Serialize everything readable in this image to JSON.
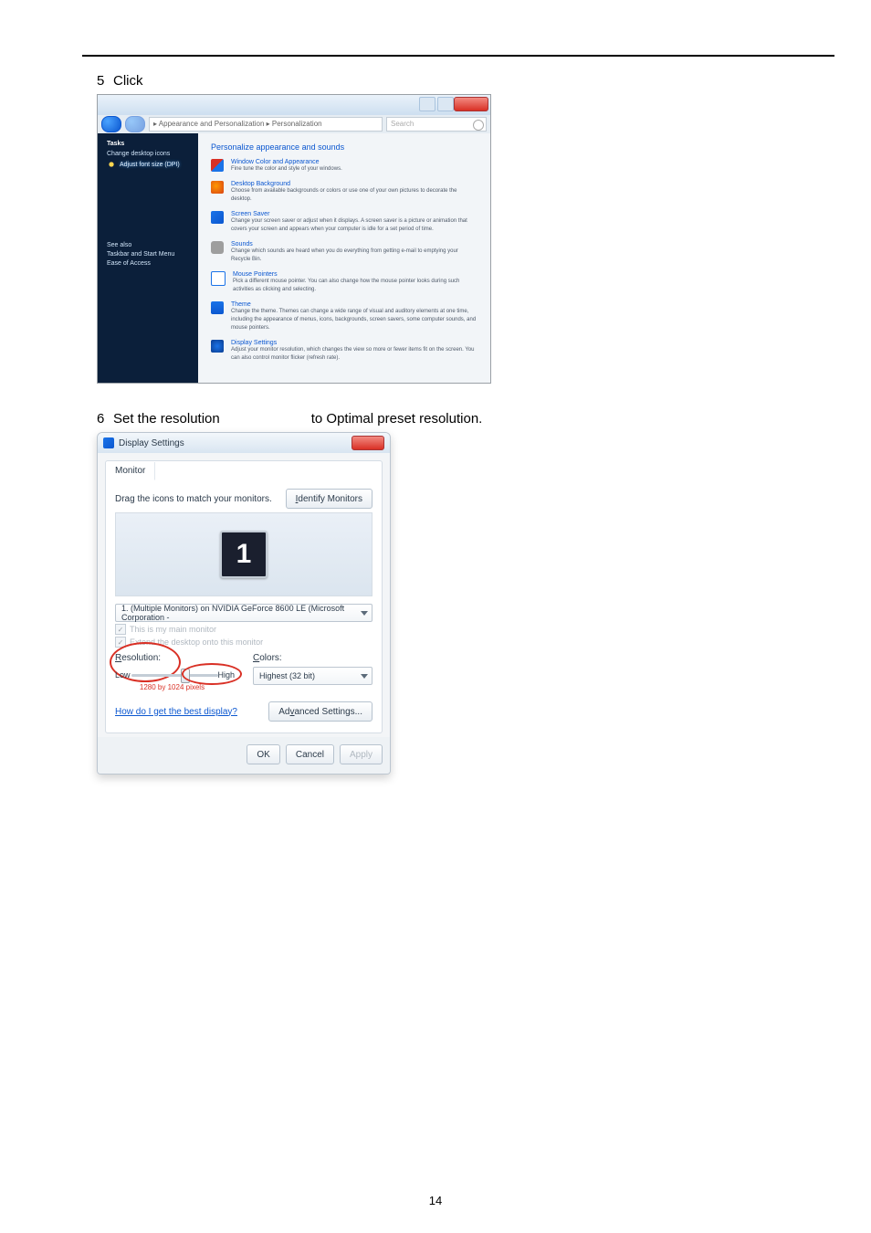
{
  "steps": {
    "s5": {
      "num": "5",
      "text": "Click"
    },
    "s6": {
      "num": "6",
      "text_left": "Set the resolution",
      "text_right": "to Optimal preset resolution."
    }
  },
  "personalization": {
    "address_path": "▸ Appearance and Personalization ▸ Personalization",
    "search_placeholder": "Search",
    "sidebar": {
      "header": "Tasks",
      "link1": "Change desktop icons",
      "link2": "Adjust font size (DPI)",
      "footer": {
        "a": "See also",
        "b": "Taskbar and Start Menu",
        "c": "Ease of Access"
      }
    },
    "main": {
      "title": "Personalize appearance and sounds",
      "items": [
        {
          "name": "Window Color and Appearance",
          "desc": "Fine tune the color and style of your windows."
        },
        {
          "name": "Desktop Background",
          "desc": "Choose from available backgrounds or colors or use one of your own pictures to decorate the desktop."
        },
        {
          "name": "Screen Saver",
          "desc": "Change your screen saver or adjust when it displays. A screen saver is a picture or animation that covers your screen and appears when your computer is idle for a set period of time."
        },
        {
          "name": "Sounds",
          "desc": "Change which sounds are heard when you do everything from getting e-mail to emptying your Recycle Bin."
        },
        {
          "name": "Mouse Pointers",
          "desc": "Pick a different mouse pointer. You can also change how the mouse pointer looks during such activities as clicking and selecting."
        },
        {
          "name": "Theme",
          "desc": "Change the theme. Themes can change a wide range of visual and auditory elements at one time, including the appearance of menus, icons, backgrounds, screen savers, some computer sounds, and mouse pointers."
        },
        {
          "name": "Display Settings",
          "desc": "Adjust your monitor resolution, which changes the view so more or fewer items fit on the screen. You can also control monitor flicker (refresh rate)."
        }
      ]
    }
  },
  "display": {
    "title": "Display Settings",
    "tab": "Monitor",
    "drag_label": "Drag the icons to match your monitors.",
    "identify_btn": "Identify Monitors",
    "monitor_num": "1",
    "device_combo": "1. (Multiple Monitors) on NVIDIA GeForce 8600 LE (Microsoft Corporation - ",
    "chk_main": "This is my main monitor",
    "chk_extend": "Extend the desktop onto this monitor",
    "res_label": "Resolution:",
    "res_low": "Low",
    "res_high": "High",
    "res_under": "1280 by 1024 pixels",
    "color_label": "Colors:",
    "color_value": "Highest (32 bit)",
    "help_link": "How do I get the best display?",
    "adv_btn": "Advanced Settings...",
    "ok": "OK",
    "cancel": "Cancel",
    "apply": "Apply"
  },
  "page_number": "14"
}
